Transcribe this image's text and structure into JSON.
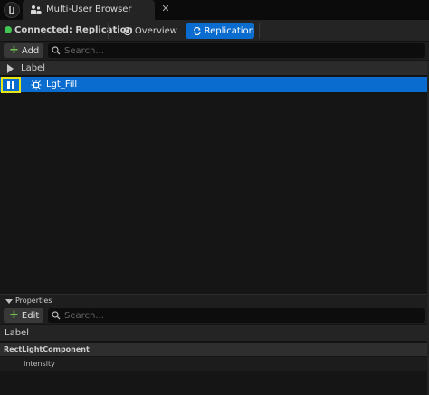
{
  "window": {
    "tab_title": "Multi-User Browser",
    "close_glyph": "✕"
  },
  "session": {
    "status": "Connected: Replication",
    "status_color": "#3fc653",
    "overview_label": "Overview",
    "replication_label": "Replication",
    "accent_color": "#0a6cce"
  },
  "toolbar": {
    "add_label": "Add",
    "search_placeholder": "Search..."
  },
  "tree": {
    "column_label": "Label",
    "rows": [
      {
        "label": "Lgt_Fill",
        "icon": "light-icon",
        "selected": true
      }
    ]
  },
  "properties": {
    "title": "Properties",
    "edit_label": "Edit",
    "search_placeholder": "Search...",
    "label_row": "Label",
    "category": "RectLightComponent",
    "property": "Intensity"
  }
}
